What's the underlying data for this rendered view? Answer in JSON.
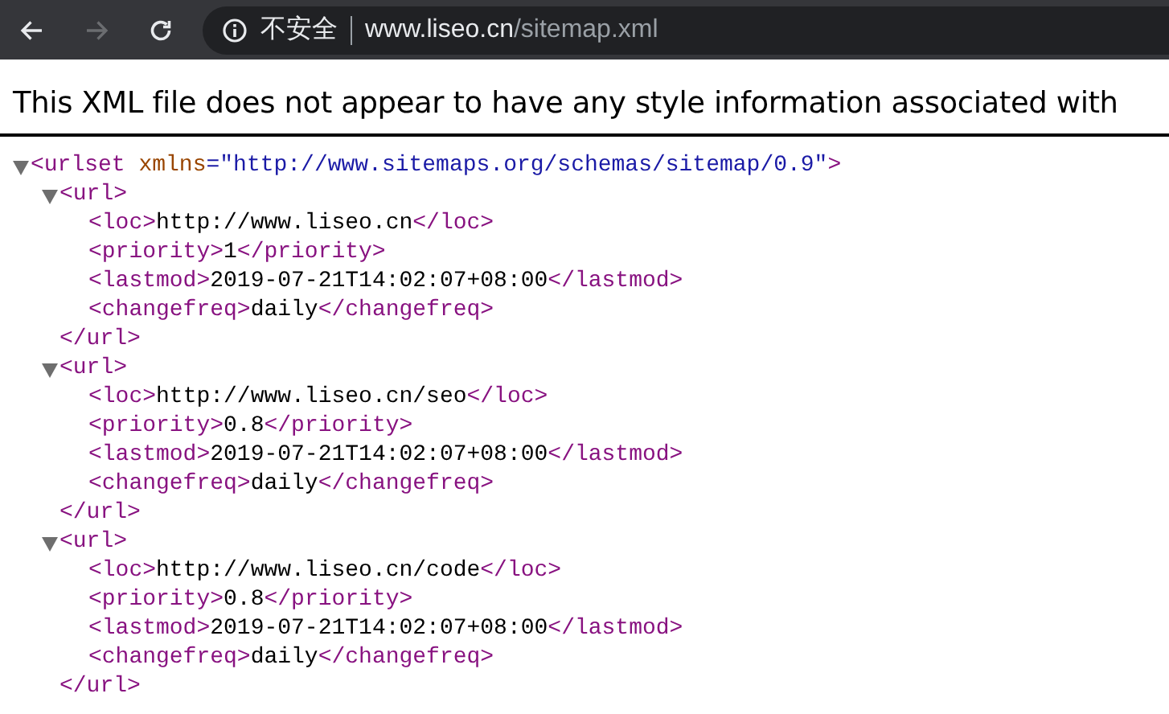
{
  "toolbar": {
    "back": {
      "disabled": false
    },
    "forward": {
      "disabled": true
    },
    "address": {
      "security_label": "不安全",
      "host": "www.liseo.cn",
      "path": "/sitemap.xml"
    }
  },
  "notice": "This XML file does not appear to have any style information associated with",
  "tree": {
    "open": "<urlset",
    "attribute_name": " xmlns",
    "attribute_value": "=\"http://www.sitemaps.org/schemas/sitemap/0.9\"",
    "open_end": ">",
    "expanded": true,
    "children": [
      {
        "open": "<url",
        "open_end": ">",
        "close": "</url>",
        "expanded": true,
        "children": [
          {
            "open": "<loc>",
            "text": "http://www.liseo.cn",
            "close": "</loc>"
          },
          {
            "open": "<priority>",
            "text": "1",
            "close": "</priority>"
          },
          {
            "open": "<lastmod>",
            "text": "2019-07-21T14:02:07+08:00",
            "close": "</lastmod>"
          },
          {
            "open": "<changefreq>",
            "text": "daily",
            "close": "</changefreq>"
          }
        ]
      },
      {
        "open": "<url",
        "open_end": ">",
        "close": "</url>",
        "expanded": true,
        "children": [
          {
            "open": "<loc>",
            "text": "http://www.liseo.cn/seo",
            "close": "</loc>"
          },
          {
            "open": "<priority>",
            "text": "0.8",
            "close": "</priority>"
          },
          {
            "open": "<lastmod>",
            "text": "2019-07-21T14:02:07+08:00",
            "close": "</lastmod>"
          },
          {
            "open": "<changefreq>",
            "text": "daily",
            "close": "</changefreq>"
          }
        ]
      },
      {
        "open": "<url",
        "open_end": ">",
        "close": "</url>",
        "expanded": true,
        "children": [
          {
            "open": "<loc>",
            "text": "http://www.liseo.cn/code",
            "close": "</loc>"
          },
          {
            "open": "<priority>",
            "text": "0.8",
            "close": "</priority>"
          },
          {
            "open": "<lastmod>",
            "text": "2019-07-21T14:02:07+08:00",
            "close": "</lastmod>"
          },
          {
            "open": "<changefreq>",
            "text": "daily",
            "close": "</changefreq>"
          }
        ]
      }
    ]
  }
}
